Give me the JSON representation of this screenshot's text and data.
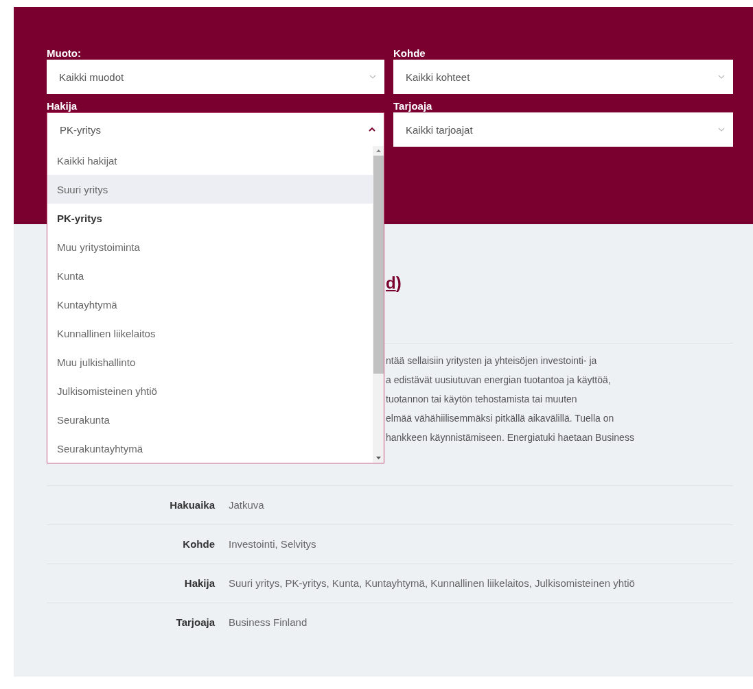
{
  "filters": [
    {
      "label": "Muoto:",
      "value": "Kaikki muodot",
      "expanded": false
    },
    {
      "label": "Kohde",
      "value": "Kaikki kohteet",
      "expanded": false
    },
    {
      "label": "Hakija",
      "value": "PK-yritys",
      "expanded": true,
      "options": [
        {
          "label": "Kaikki hakijat",
          "selected": false,
          "hovered": false
        },
        {
          "label": "Suuri yritys",
          "selected": false,
          "hovered": true
        },
        {
          "label": "PK-yritys",
          "selected": true,
          "hovered": false
        },
        {
          "label": "Muu yritystoiminta",
          "selected": false,
          "hovered": false
        },
        {
          "label": "Kunta",
          "selected": false,
          "hovered": false
        },
        {
          "label": "Kuntayhtymä",
          "selected": false,
          "hovered": false
        },
        {
          "label": "Kunnallinen liikelaitos",
          "selected": false,
          "hovered": false
        },
        {
          "label": "Muu julkishallinto",
          "selected": false,
          "hovered": false
        },
        {
          "label": "Julkisomisteinen yhtiö",
          "selected": false,
          "hovered": false
        },
        {
          "label": "Seurakunta",
          "selected": false,
          "hovered": false
        },
        {
          "label": "Seurakuntayhtymä",
          "selected": false,
          "hovered": false
        }
      ]
    },
    {
      "label": "Tarjoaja",
      "value": "Kaikki tarjoajat",
      "expanded": false
    }
  ],
  "result": {
    "title_link": "d",
    "title_rest": ")",
    "description_lines": [
      "ntää sellaisiin yritysten ja yhteisöjen investointi- ja",
      "a edistävät uusiutuvan energian tuotantoa ja käyttöä,",
      "tuotannon tai käytön tehostamista tai muuten",
      "elmää vähähiilisemmäksi pitkällä aikavälillä. Tuella on",
      "hankkeen käynnistämiseen. Energiatuki haetaan Business"
    ],
    "details": [
      {
        "label": "Hakuaika",
        "value": "Jatkuva"
      },
      {
        "label": "Kohde",
        "value": "Investointi, Selvitys"
      },
      {
        "label": "Hakija",
        "value": "Suuri yritys, PK-yritys, Kunta, Kuntayhtymä, Kunnallinen liikelaitos, Julkisomisteinen yhtiö"
      },
      {
        "label": "Tarjoaja",
        "value": "Business Finland"
      }
    ]
  }
}
